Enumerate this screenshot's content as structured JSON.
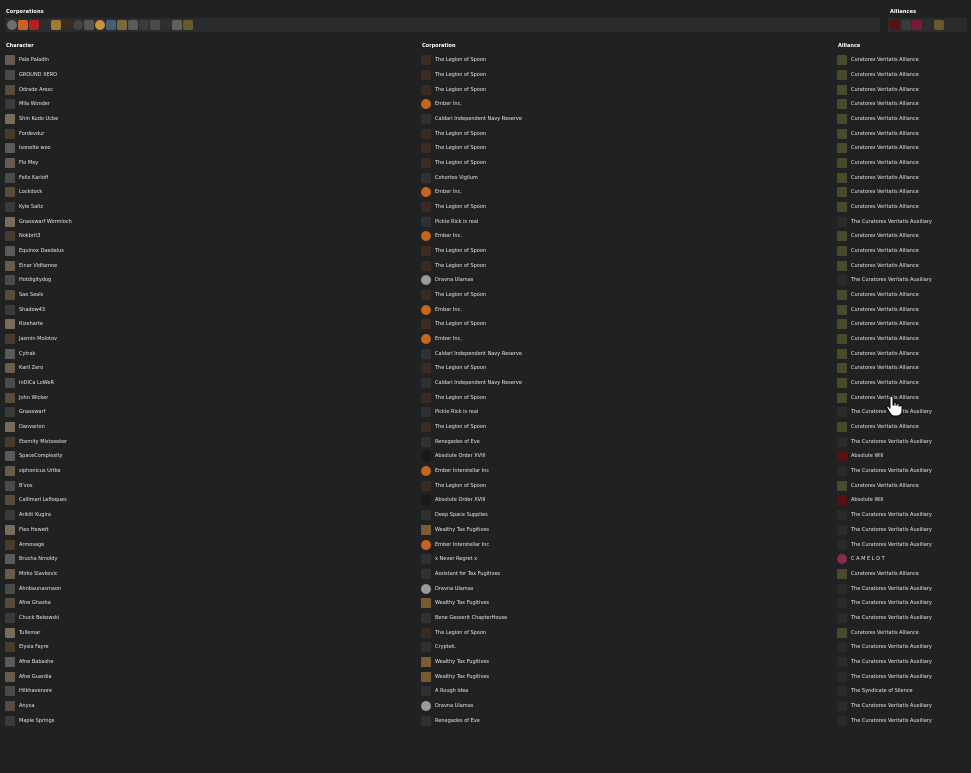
{
  "headers": {
    "corporations": "Corporations",
    "alliances": "Alliances",
    "character": "Character",
    "corporation": "Corporation",
    "alliance": "Alliance"
  },
  "colors": {
    "background": "#202123",
    "bar": "#2a2b2d",
    "legion": "#3a2a22",
    "ember": "#c8641e",
    "curatores": "#3a3a2a",
    "auxiliary": "#2c2c2c",
    "absolute": "#4a1414"
  },
  "corp_bar_icons": [
    "corp-icon-1",
    "corp-icon-2",
    "corp-icon-3",
    "corp-icon-4",
    "corp-icon-5",
    "corp-icon-6",
    "corp-icon-7",
    "corp-icon-8",
    "corp-icon-9",
    "corp-icon-10",
    "corp-icon-11",
    "corp-icon-12",
    "corp-icon-13",
    "corp-icon-14",
    "corp-icon-15",
    "corp-icon-16",
    "corp-icon-17"
  ],
  "alliance_bar_icons": [
    "alliance-icon-1",
    "alliance-icon-2",
    "alliance-icon-3",
    "alliance-icon-4",
    "alliance-icon-5"
  ],
  "rows": [
    {
      "character": "Pale Paladin",
      "corporation": "The Legion of Spoon",
      "alliance": "Curatores Veritatis Alliance"
    },
    {
      "character": "GROUND XERO",
      "corporation": "The Legion of Spoon",
      "alliance": "Curatores Veritatis Alliance"
    },
    {
      "character": "Odrade Arexc",
      "corporation": "The Legion of Spoon",
      "alliance": "Curatores Veritatis Alliance"
    },
    {
      "character": "Mila Wonder",
      "corporation": "Ember Inc.",
      "alliance": "Curatores Veritatis Alliance"
    },
    {
      "character": "Shin Kudo Ucbe",
      "corporation": "Caldari Independent Navy Reserve",
      "alliance": "Curatores Veritatis Alliance"
    },
    {
      "character": "Fordevdur",
      "corporation": "The Legion of Spoon",
      "alliance": "Curatores Veritatis Alliance"
    },
    {
      "character": "Isonelte woo",
      "corporation": "The Legion of Spoon",
      "alliance": "Curatores Veritatis Alliance"
    },
    {
      "character": "Flo Mey",
      "corporation": "The Legion of Spoon",
      "alliance": "Curatores Veritatis Alliance"
    },
    {
      "character": "Felix Karloff",
      "corporation": "Cohortes Vigilum",
      "alliance": "Curatores Veritatis Alliance"
    },
    {
      "character": "Lockdock",
      "corporation": "Ember Inc.",
      "alliance": "Curatores Veritatis Alliance"
    },
    {
      "character": "Kyle Saltz",
      "corporation": "The Legion of Spoon",
      "alliance": "Curatores Veritatis Alliance"
    },
    {
      "character": "Gnasswarf Wormloch",
      "corporation": "Pickle Rick is real",
      "alliance": "The Curatores Veritatis Auxiliary"
    },
    {
      "character": "Nokbrit3",
      "corporation": "Ember Inc.",
      "alliance": "Curatores Veritatis Alliance"
    },
    {
      "character": "Equinox Daedalus",
      "corporation": "The Legion of Spoon",
      "alliance": "Curatores Veritatis Alliance"
    },
    {
      "character": "Einar Vidfamne",
      "corporation": "The Legion of Spoon",
      "alliance": "Curatores Veritatis Alliance"
    },
    {
      "character": "Hotdigitydog",
      "corporation": "Dravna Ulamas",
      "alliance": "The Curatores Veritatis Auxiliary"
    },
    {
      "character": "Sae Seals",
      "corporation": "The Legion of Spoon",
      "alliance": "Curatores Veritatis Alliance"
    },
    {
      "character": "Shadow43",
      "corporation": "Ember Inc.",
      "alliance": "Curatores Veritatis Alliance"
    },
    {
      "character": "Rizeharte",
      "corporation": "The Legion of Spoon",
      "alliance": "Curatores Veritatis Alliance"
    },
    {
      "character": "Jasmin Molotov",
      "corporation": "Ember Inc.",
      "alliance": "Curatores Veritatis Alliance"
    },
    {
      "character": "Cytrak",
      "corporation": "Caldari Independent Navy Reserve",
      "alliance": "Curatores Veritatis Alliance"
    },
    {
      "character": "Karll Zero",
      "corporation": "The Legion of Spoon",
      "alliance": "Curatores Veritatis Alliance"
    },
    {
      "character": "InDiCa LoWeR",
      "corporation": "Caldari Independent Navy Reserve",
      "alliance": "Curatores Veritatis Alliance"
    },
    {
      "character": "John Wicker",
      "corporation": "The Legion of Spoon",
      "alliance": "Curatores Veritatis Alliance"
    },
    {
      "character": "Gnasswarf",
      "corporation": "Pickle Rick is real",
      "alliance": "The Curatores Veritatis Auxiliary"
    },
    {
      "character": "Danvarion",
      "corporation": "The Legion of Spoon",
      "alliance": "Curatores Veritatis Alliance"
    },
    {
      "character": "Eternity Mistseeker",
      "corporation": "Renegades of Eve",
      "alliance": "The Curatores Veritatis Auxiliary"
    },
    {
      "character": "SpaceComplexity",
      "corporation": "Absolute Order XVIII",
      "alliance": "Absolute Will"
    },
    {
      "character": "siphonicus Urtke",
      "corporation": "Ember Interstellar Inc",
      "alliance": "The Curatores Veritatis Auxiliary"
    },
    {
      "character": "B'vos",
      "corporation": "The Legion of Spoon",
      "alliance": "Curatores Veritatis Alliance"
    },
    {
      "character": "Callimari Lefloques",
      "corporation": "Absolute Order XVIII",
      "alliance": "Absolute Will"
    },
    {
      "character": "Arikiti Kugira",
      "corporation": "Deep Space Supplies",
      "alliance": "The Curatores Veritatis Auxiliary"
    },
    {
      "character": "Flex Hewett",
      "corporation": "Wealthy Tax Fugitives",
      "alliance": "The Curatores Veritatis Auxiliary"
    },
    {
      "character": "Armosage",
      "corporation": "Ember Interstellar Inc",
      "alliance": "The Curatores Veritatis Auxiliary"
    },
    {
      "character": "Brucha Nmoldy",
      "corporation": "x Never Regret x",
      "alliance": "C A M E L O T"
    },
    {
      "character": "Mirko Slavkovic",
      "corporation": "Assistant for Tax Fugitives",
      "alliance": "Curatores Veritatis Alliance"
    },
    {
      "character": "Ahnbaunasmaon",
      "corporation": "Dravna Ulamas",
      "alliance": "The Curatores Veritatis Auxiliary"
    },
    {
      "character": "Afne Ghasha",
      "corporation": "Wealthy Tax Fugitives",
      "alliance": "The Curatores Veritatis Auxiliary"
    },
    {
      "character": "Chuck Bekowski",
      "corporation": "Bene Gesserit ChapterHouse",
      "alliance": "The Curatores Veritatis Auxiliary"
    },
    {
      "character": "Tullemar",
      "corporation": "The Legion of Spoon",
      "alliance": "Curatores Veritatis Alliance"
    },
    {
      "character": "Elysia Fayre",
      "corporation": "Cryptek.",
      "alliance": "The Curatores Veritatis Auxiliary"
    },
    {
      "character": "Afne Babashe",
      "corporation": "Wealthy Tax Fugitives",
      "alliance": "The Curatores Veritatis Auxiliary"
    },
    {
      "character": "Afne Guardia",
      "corporation": "Wealthy Tax Fugitives",
      "alliance": "The Curatores Veritatis Auxiliary"
    },
    {
      "character": "Hilkhavenore",
      "corporation": "A Rough Idea",
      "alliance": "The Syndicate of Silence"
    },
    {
      "character": "Anyxa",
      "corporation": "Dravna Ulamas",
      "alliance": "The Curatores Veritatis Auxiliary"
    },
    {
      "character": "Maple Springs",
      "corporation": "Renegades of Eve",
      "alliance": "The Curatores Veritatis Auxiliary"
    }
  ]
}
